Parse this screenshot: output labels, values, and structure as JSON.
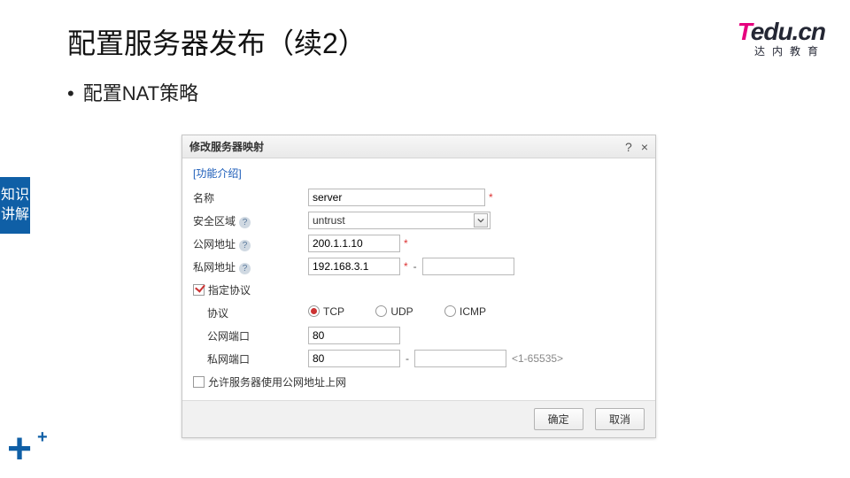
{
  "page": {
    "title": "配置服务器发布（续2）",
    "bullet": "配置NAT策略"
  },
  "logo": {
    "brand_t": "T",
    "brand_rest": "edu.cn",
    "sub": "达内教育"
  },
  "sidebar": {
    "tab": "知识讲解"
  },
  "dialog": {
    "title": "修改服务器映射",
    "help_glyph": "?",
    "close_glyph": "×",
    "intro_link": "[功能介绍]",
    "labels": {
      "name": "名称",
      "zone": "安全区域",
      "public_ip": "公网地址",
      "private_ip": "私网地址",
      "specify_proto": "指定协议",
      "proto": "协议",
      "public_port": "公网端口",
      "private_port": "私网端口",
      "allow_internet": "允许服务器使用公网地址上网"
    },
    "values": {
      "name": "server",
      "zone": "untrust",
      "public_ip": "200.1.1.10",
      "private_ip_start": "192.168.3.1",
      "private_ip_end": "",
      "public_port": "80",
      "private_port_start": "80",
      "private_port_end": ""
    },
    "proto_options": {
      "tcp": "TCP",
      "udp": "UDP",
      "icmp": "ICMP"
    },
    "port_hint": "<1-65535>",
    "buttons": {
      "ok": "确定",
      "cancel": "取消"
    }
  }
}
